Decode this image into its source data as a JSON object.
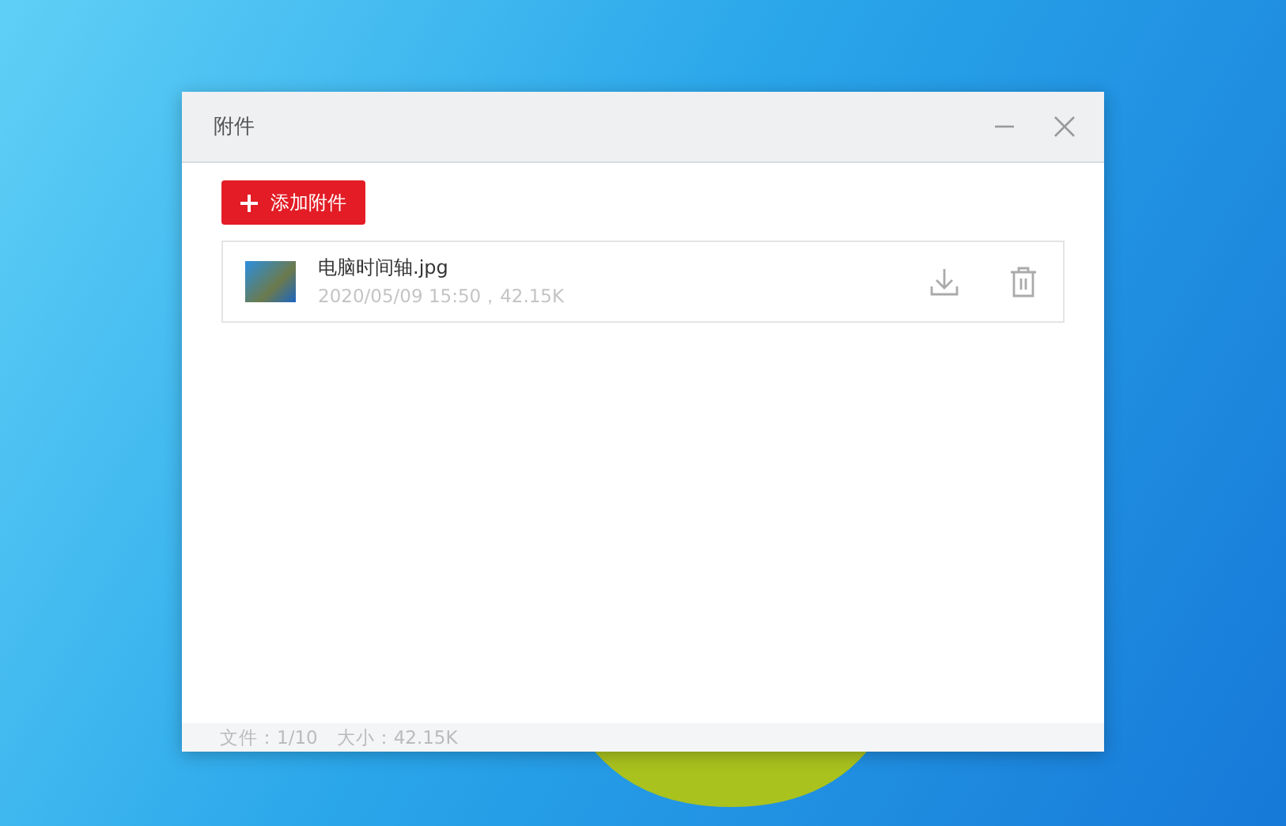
{
  "window": {
    "title": "附件"
  },
  "add_button": {
    "label": "添加附件"
  },
  "files": [
    {
      "name": "电脑时间轴.jpg",
      "meta": "2020/05/09 15:50，42.15K"
    }
  ],
  "status_bar": {
    "count": "文件：1/10",
    "size": "大小：42.15K"
  }
}
